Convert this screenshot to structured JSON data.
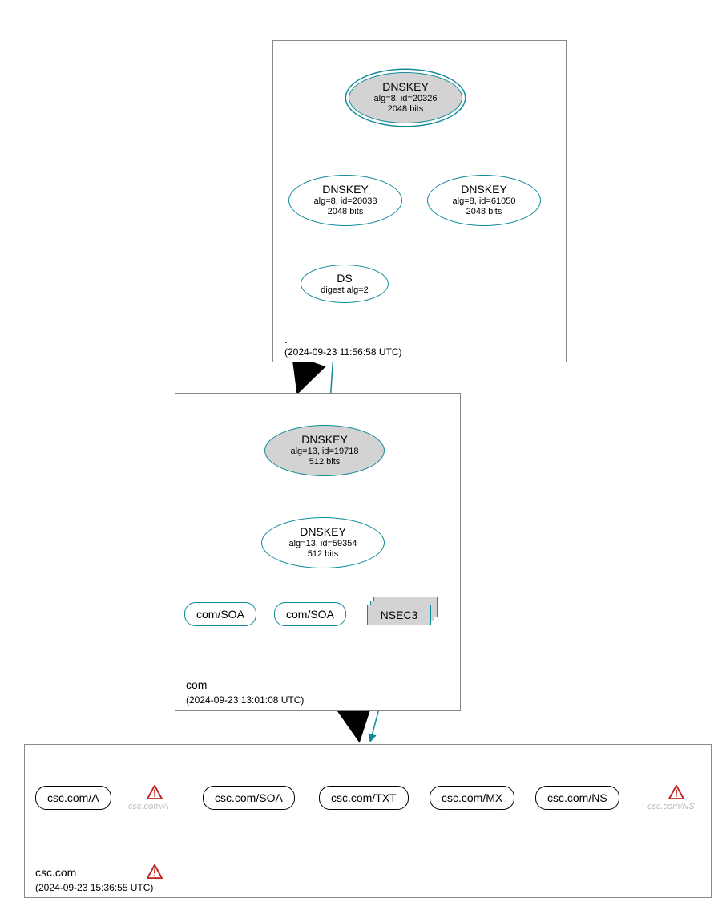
{
  "zones": {
    "root": {
      "label": ".",
      "timestamp": "(2024-09-23 11:56:58 UTC)",
      "dnskey_ksk": {
        "title": "DNSKEY",
        "sub1": "alg=8, id=20326",
        "sub2": "2048 bits"
      },
      "dnskey_zsk1": {
        "title": "DNSKEY",
        "sub1": "alg=8, id=20038",
        "sub2": "2048 bits"
      },
      "dnskey_zsk2": {
        "title": "DNSKEY",
        "sub1": "alg=8, id=61050",
        "sub2": "2048 bits"
      },
      "ds": {
        "title": "DS",
        "sub1": "digest alg=2"
      }
    },
    "com": {
      "label": "com",
      "timestamp": "(2024-09-23 13:01:08 UTC)",
      "dnskey_ksk": {
        "title": "DNSKEY",
        "sub1": "alg=13, id=19718",
        "sub2": "512 bits"
      },
      "dnskey_zsk": {
        "title": "DNSKEY",
        "sub1": "alg=13, id=59354",
        "sub2": "512 bits"
      },
      "soa1": "com/SOA",
      "soa2": "com/SOA",
      "nsec3": "NSEC3"
    },
    "csc": {
      "label": "csc.com",
      "timestamp": "(2024-09-23 15:36:55 UTC)",
      "records": {
        "a": "csc.com/A",
        "soa": "csc.com/SOA",
        "txt": "csc.com/TXT",
        "mx": "csc.com/MX",
        "ns": "csc.com/NS"
      },
      "warnings": {
        "a": "csc.com/A",
        "ns": "csc.com/NS"
      }
    }
  }
}
